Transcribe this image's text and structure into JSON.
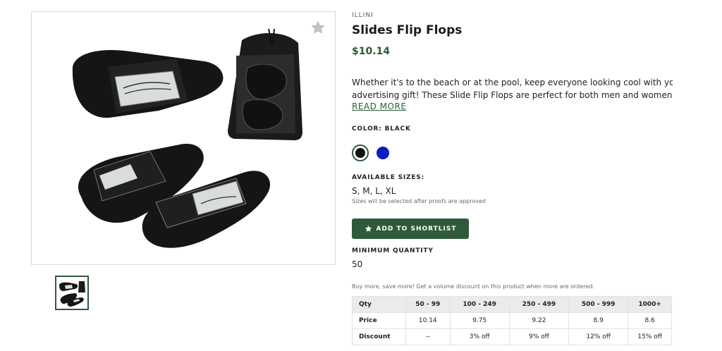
{
  "product": {
    "brand": "ILLINI",
    "title": "Slides Flip Flops",
    "price": "$10.14",
    "description_line1": "Whether it's to the beach or at the pool, keep everyone looking cool with your next",
    "description_line2": "advertising gift! These Slide Flip Flops are perfect for both men and women with th…",
    "read_more_label": "READ MORE",
    "color_label": "COLOR: BLACK",
    "swatches": [
      {
        "name": "Black",
        "hex": "#111111",
        "selected": true
      },
      {
        "name": "Blue",
        "hex": "#0a1fc0",
        "selected": false
      }
    ],
    "sizes_label": "AVAILABLE SIZES:",
    "sizes_value": "S, M, L, XL",
    "sizes_note": "Sizes will be selected after proofs are approved",
    "shortlist_label": "ADD TO SHORTLIST",
    "min_qty_label": "MINIMUM QUANTITY",
    "min_qty_value": "50",
    "discount_note": "Buy more, save more! Get a volume discount on this product when more are ordered.",
    "accent_color": "#2f5a3a",
    "favorite_icon": "star-icon"
  },
  "pricing_table": {
    "header": [
      "Qty",
      "50 - 99",
      "100 - 249",
      "250 - 499",
      "500 - 999",
      "1000+"
    ],
    "price_row": [
      "Price",
      "10.14",
      "9.75",
      "9.22",
      "8.9",
      "8.6"
    ],
    "discount_row": [
      "Discount",
      "--",
      "3% off",
      "9% off",
      "12% off",
      "15% off"
    ]
  }
}
